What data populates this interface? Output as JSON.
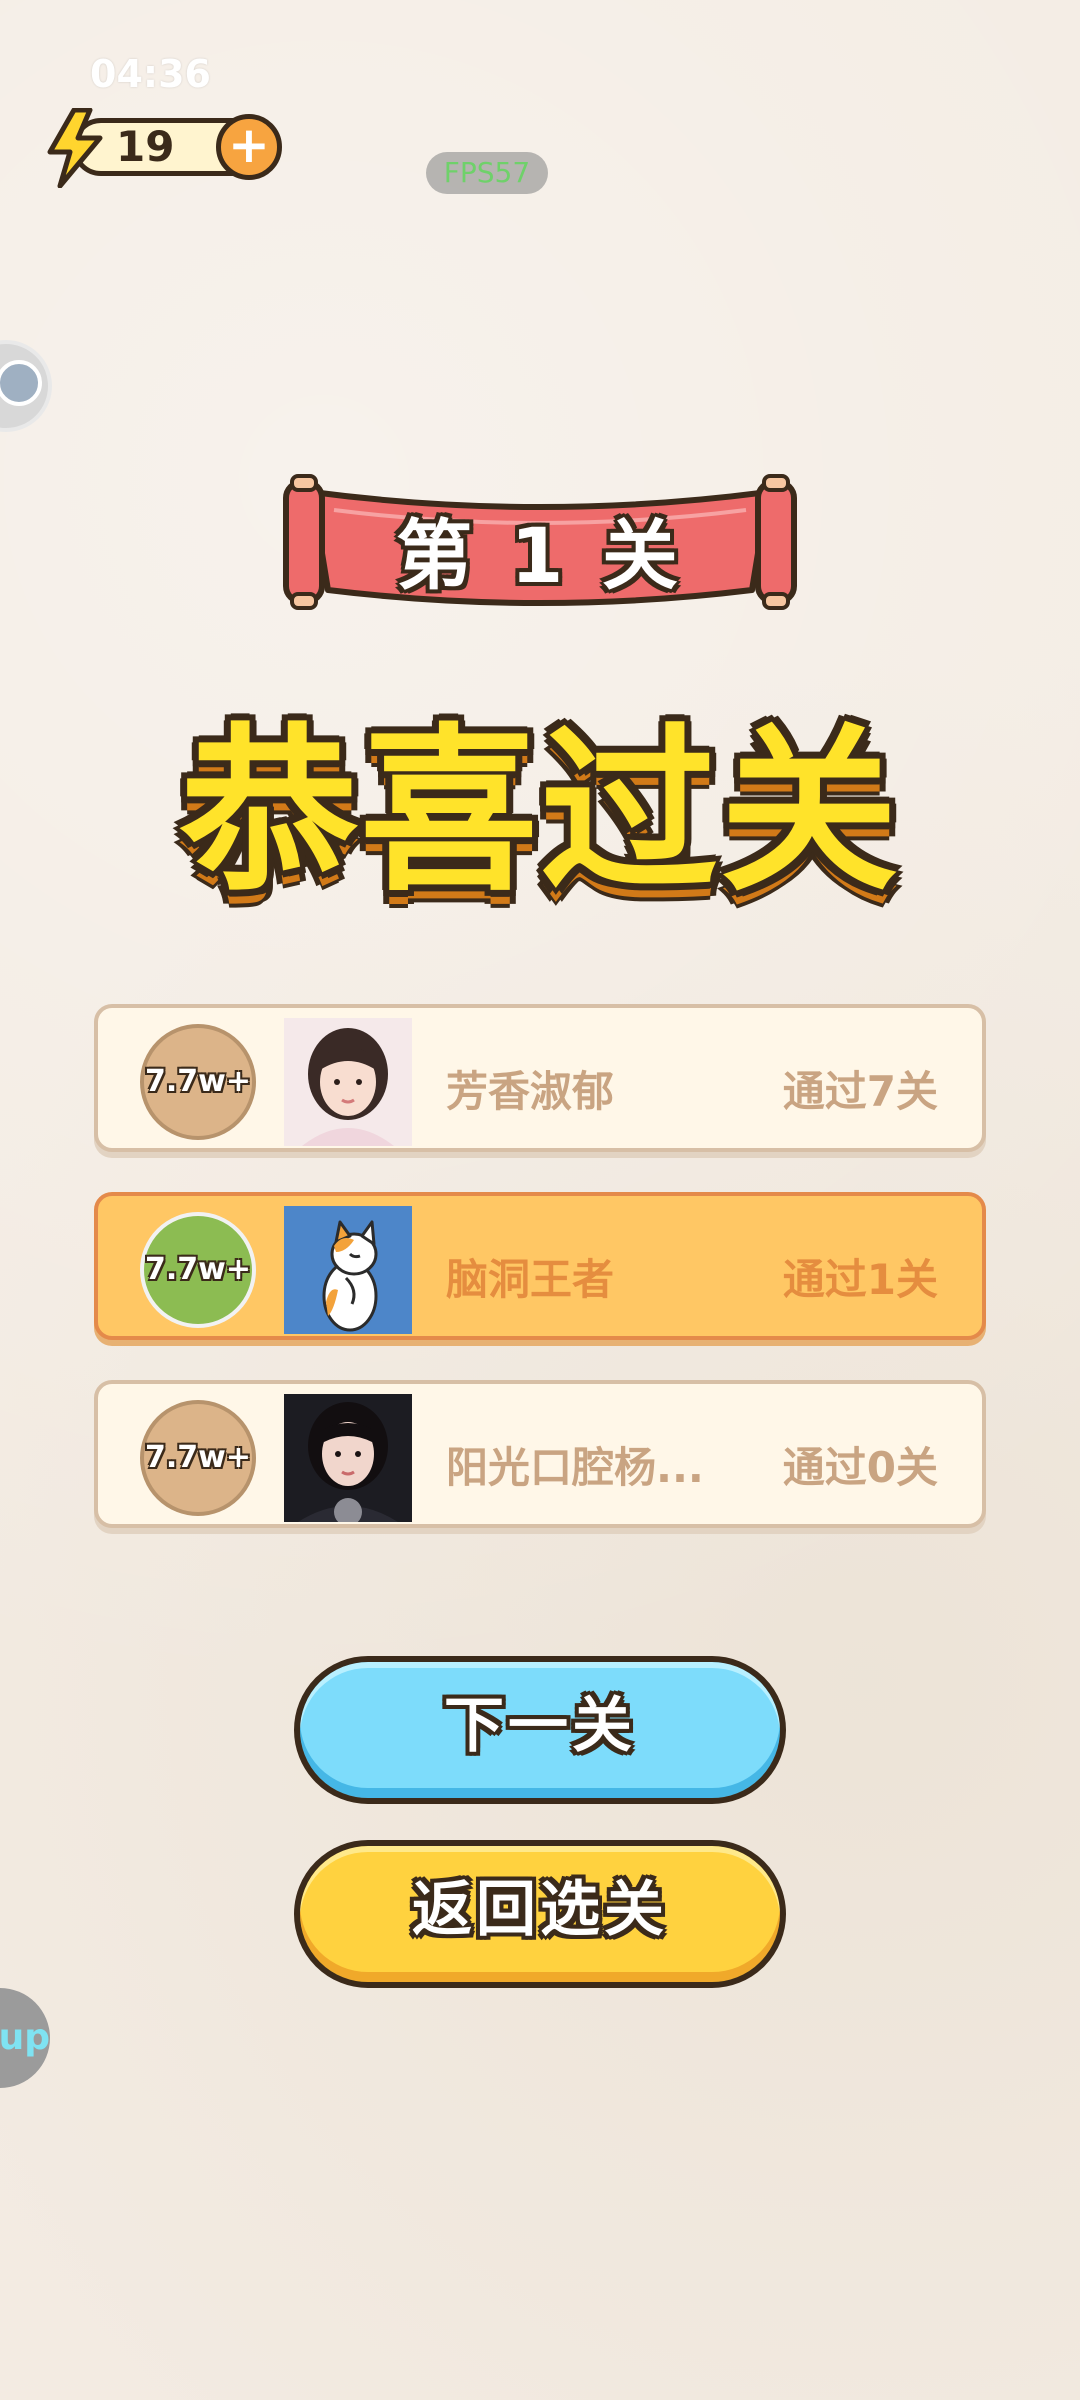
{
  "status": {
    "time": "04:36"
  },
  "energy": {
    "count": "19",
    "plus_label": "+"
  },
  "fps": "FPS57",
  "side": {
    "help_label": "up"
  },
  "level_banner": {
    "text": "第 1 关"
  },
  "headline": "恭喜过关",
  "ranking": [
    {
      "badge": "7.7w+",
      "name": "芳香淑郁",
      "progress": "通过7关",
      "is_self": false,
      "avatar": "girl-portrait"
    },
    {
      "badge": "7.7w+",
      "name": "脑洞王者",
      "progress": "通过1关",
      "is_self": true,
      "avatar": "cat-illustration"
    },
    {
      "badge": "7.7w+",
      "name": "阳光口腔杨...",
      "progress": "通过0关",
      "is_self": false,
      "avatar": "woman-portrait"
    }
  ],
  "buttons": {
    "next": "下一关",
    "back": "返回选关"
  },
  "colors": {
    "background": "#f3ebe2",
    "headline_fill": "#ffe32a",
    "banner_red": "#ee6b6b",
    "next_button": "#7ddcfb",
    "back_button": "#ffd23f",
    "self_row": "#ffc764"
  }
}
